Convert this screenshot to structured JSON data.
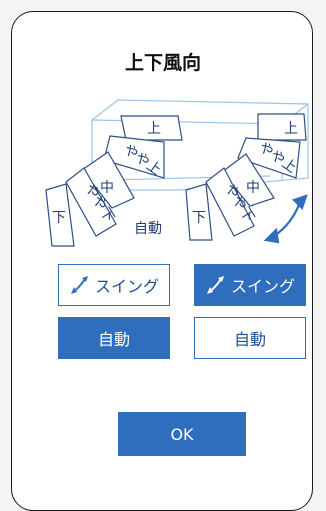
{
  "dialog": {
    "title": "上下風向"
  },
  "left_fan": {
    "segments": [
      "上",
      "やや上",
      "中",
      "やや下",
      "下"
    ],
    "auto_label": "自動"
  },
  "right_fan": {
    "segments": [
      "上",
      "やや上",
      "中",
      "やや下",
      "下"
    ]
  },
  "buttons": {
    "swing_left": "スイング",
    "swing_right": "スイング",
    "auto_left": "自動",
    "auto_right": "自動",
    "ok": "OK"
  },
  "colors": {
    "accent": "#2f6dbd",
    "accent_text": "#1f4f8f",
    "unit_outline": "#9ec4e8"
  },
  "icons": {
    "swing": "swing-arrow-icon"
  }
}
